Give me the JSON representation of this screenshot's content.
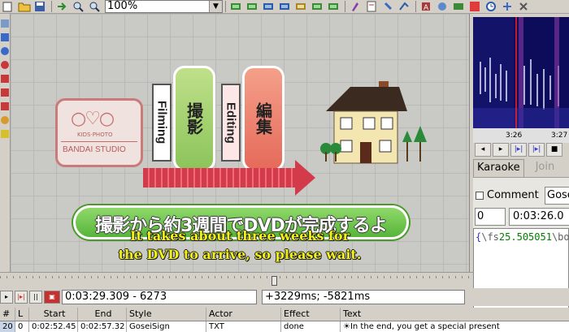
{
  "toolbar": {
    "zoom_value": "100%",
    "buttons": [
      "open-icon",
      "save-icon",
      "folder-icon",
      "jump-icon",
      "zoom-in-icon",
      "zoom-out-icon",
      "layout-icons",
      "style-icon",
      "properties-icon",
      "attach-icon",
      "translation-icon",
      "fonts-icon",
      "resample-icon",
      "timing-icon",
      "kanji-icon",
      "clock-icon",
      "options-icon"
    ]
  },
  "video": {
    "logo_text": "BANDAI STUDIO",
    "logo_small": "KIDS·PHOTO",
    "step1_en": "Filming",
    "step1_jp": "撮影",
    "step2_en": "Editing",
    "step2_jp": "編集",
    "banner_jp": "撮影から約3週間でDVDが完成するよ",
    "subtitle_line1": "It takes about three weeks for",
    "subtitle_line2": "the DVD to arrive, so please wait."
  },
  "audio": {
    "tick1": "3:26",
    "tick2": "3:27"
  },
  "edit_panel": {
    "tab_karaoke": "Karaoke",
    "tab_join": "Join",
    "comment_label": "Comment",
    "style_value": "Gose",
    "layer_value": "0",
    "start_time": "0:03:26.0",
    "text_brace_open": "{",
    "text_override": "\\fs",
    "text_number": "25.505051",
    "text_rest": "\\bor"
  },
  "playback": {
    "current_time": "0:03:29.309 - 6273",
    "offset": "+3229ms; -5821ms"
  },
  "grid": {
    "headers": [
      "#",
      "L",
      "Start",
      "End",
      "Style",
      "Actor",
      "Effect",
      "Text"
    ],
    "rows": [
      {
        "num": "20",
        "layer": "0",
        "start": "0:02:52.45",
        "end": "0:02:57.32",
        "style": "GoseiSign",
        "actor": "TXT",
        "effect": "done",
        "text": "☀In the end, you get a special present"
      }
    ]
  }
}
